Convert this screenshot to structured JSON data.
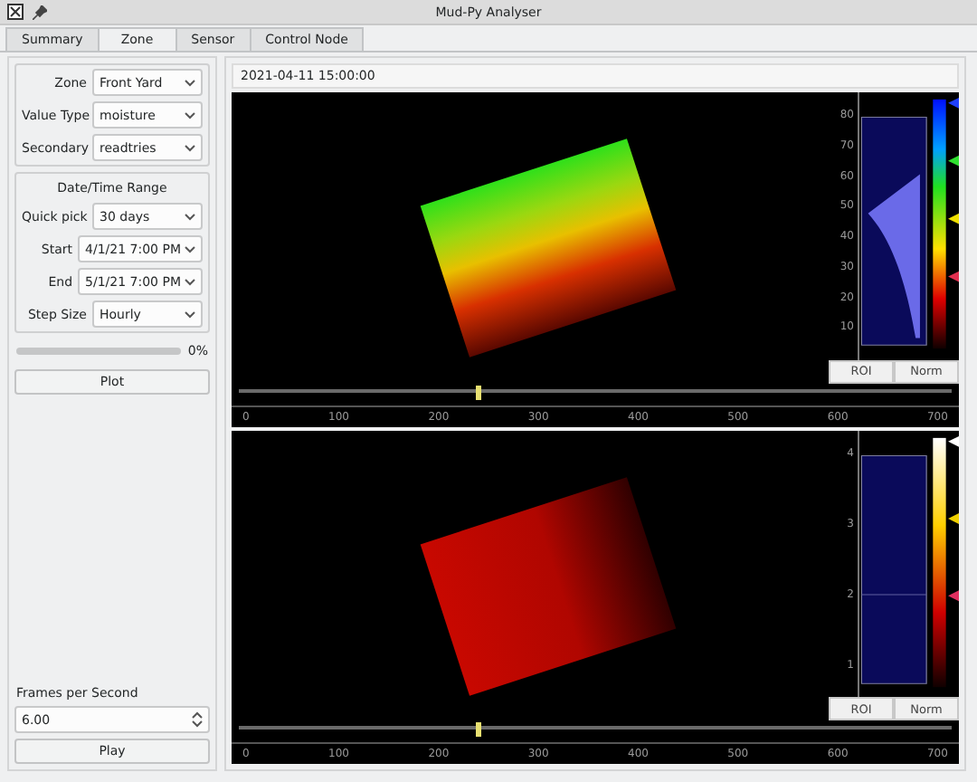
{
  "window": {
    "title": "Mud-Py Analyser"
  },
  "tabs": [
    {
      "label": "Summary",
      "selected": false
    },
    {
      "label": "Zone",
      "selected": true
    },
    {
      "label": "Sensor",
      "selected": false
    },
    {
      "label": "Control Node",
      "selected": false
    }
  ],
  "controls": {
    "fields": [
      {
        "label": "Zone",
        "value": "Front Yard"
      },
      {
        "label": "Value Type",
        "value": "moisture"
      },
      {
        "label": "Secondary",
        "value": "readtries"
      }
    ],
    "range": {
      "title": "Date/Time Range",
      "fields": [
        {
          "label": "Quick pick",
          "value": "30 days"
        },
        {
          "label": "Start",
          "value": "4/1/21 7:00 PM"
        },
        {
          "label": "End",
          "value": "5/1/21 7:00 PM"
        },
        {
          "label": "Step Size",
          "value": "Hourly"
        }
      ]
    },
    "progress": {
      "level": 0,
      "reading": "0%"
    },
    "plot_button": "Plot",
    "fps": {
      "label": "Frames per Second",
      "value": "6.00"
    },
    "play_button": "Play"
  },
  "viewer": {
    "timestamp": "2021-04-11 15:00:00",
    "views": [
      {
        "kind": "color",
        "histogram_ticks": [
          "80",
          "70",
          "60",
          "50",
          "40",
          "30",
          "20",
          "10"
        ],
        "buttons": [
          "ROI",
          "Norm"
        ],
        "timeline": {
          "level": 0.335
        },
        "timeline_ticks": [
          "0",
          "100",
          "200",
          "300",
          "400",
          "500",
          "600",
          "700"
        ]
      },
      {
        "kind": "heat",
        "histogram_ticks": [
          "4",
          "3",
          "2",
          "1"
        ],
        "buttons": [
          "ROI",
          "Norm"
        ],
        "timeline": {
          "level": 0.335
        },
        "timeline_ticks": [
          "0",
          "100",
          "200",
          "300",
          "400",
          "500",
          "600",
          "700"
        ]
      }
    ]
  }
}
